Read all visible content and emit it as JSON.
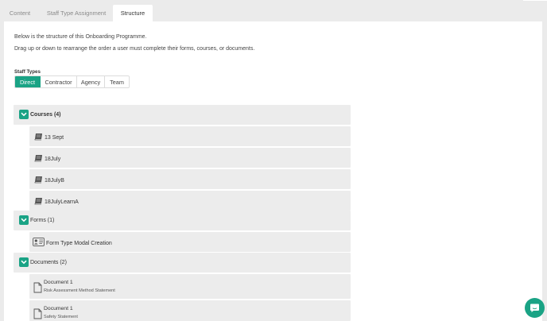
{
  "tabs": {
    "content": "Content",
    "staff_type_assignment": "Staff Type Assignment",
    "structure": "Structure",
    "active": "structure"
  },
  "intro": {
    "line1": "Below is the structure of this Onboarding Programme.",
    "line2": "Drag up or down to rearrange the order a user must complete their forms, courses, or documents."
  },
  "staff_types": {
    "label": "Staff Types",
    "options": [
      "Direct",
      "Contractor",
      "Agency",
      "Team"
    ],
    "selected": "Direct"
  },
  "structure": {
    "courses": {
      "label": "Courses (4)",
      "items": [
        "13 Sept",
        "18July",
        "18JulyB",
        "18JulyLearnA"
      ],
      "icon": "book-icon"
    },
    "forms": {
      "label": "Forms (1)",
      "items": [
        "Form Type Modal Creation"
      ],
      "icon": "id-card-icon"
    },
    "documents": {
      "label": "Documents (2)",
      "items": [
        {
          "title": "Document 1",
          "subtitle": "Risk Assessment Method Statement"
        },
        {
          "title": "Document 1",
          "subtitle": "Safety Statement"
        }
      ],
      "icon": "document-icon"
    }
  },
  "colors": {
    "accent": "#1aa385",
    "background": "#ebebeb",
    "row": "#ececec"
  },
  "chat": {
    "icon": "chat-icon"
  }
}
